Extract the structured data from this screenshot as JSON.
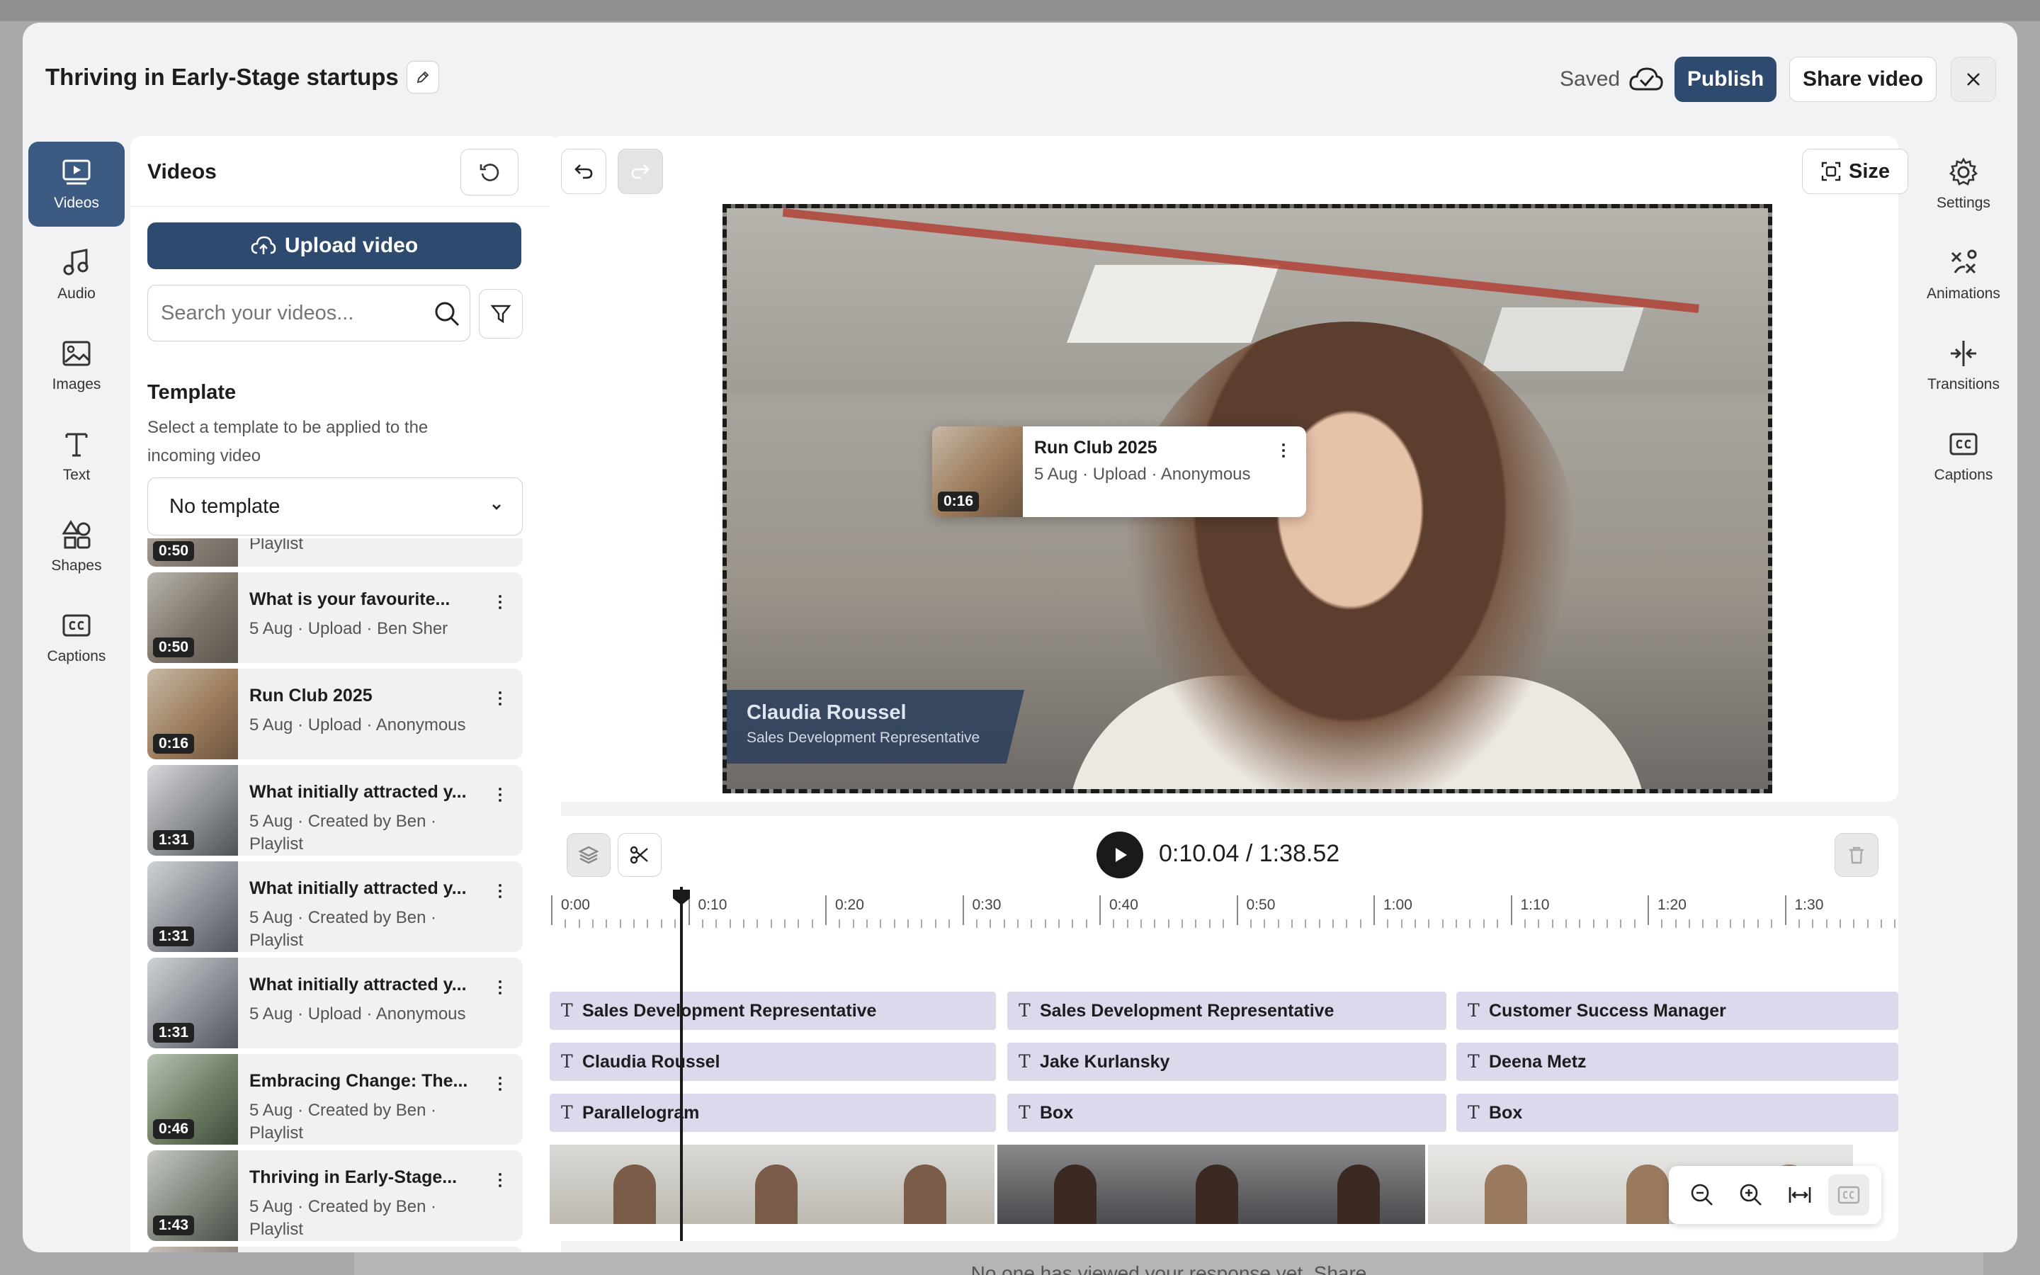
{
  "backdrop": {
    "bottom_text": "No one has viewed your response yet. Share"
  },
  "header": {
    "title": "Thriving in Early-Stage startups",
    "saved_label": "Saved",
    "publish_label": "Publish",
    "share_label": "Share video"
  },
  "left_nav": [
    {
      "label": "Videos",
      "icon": "video-icon",
      "active": true
    },
    {
      "label": "Audio",
      "icon": "music-note-icon"
    },
    {
      "label": "Images",
      "icon": "image-icon"
    },
    {
      "label": "Text",
      "icon": "text-icon"
    },
    {
      "label": "Shapes",
      "icon": "shapes-icon"
    },
    {
      "label": "Captions",
      "icon": "captions-icon"
    }
  ],
  "videos_panel": {
    "title": "Videos",
    "upload_label": "Upload video",
    "search_placeholder": "Search your videos...",
    "template_title": "Template",
    "template_desc": "Select a template to be applied to the incoming video",
    "template_value": "No template",
    "items": [
      {
        "title": "",
        "meta": "Playlist",
        "duration": "0:50"
      },
      {
        "title": "What is your favourite...",
        "meta": "5 Aug · Upload · Ben Sher",
        "duration": "0:50"
      },
      {
        "title": "Run Club 2025",
        "meta": "5 Aug · Upload · Anonymous",
        "duration": "0:16"
      },
      {
        "title": "What initially attracted y...",
        "meta": "5 Aug · Created by Ben · Playlist",
        "duration": "1:31"
      },
      {
        "title": "What initially attracted y...",
        "meta": "5 Aug · Created by Ben · Playlist",
        "duration": "1:31"
      },
      {
        "title": "What initially attracted y...",
        "meta": "5 Aug · Upload · Anonymous",
        "duration": "1:31"
      },
      {
        "title": "Embracing Change: The...",
        "meta": "5 Aug · Created by Ben · Playlist",
        "duration": "0:46"
      },
      {
        "title": "Thriving in Early-Stage...",
        "meta": "5 Aug · Created by Ben · Playlist",
        "duration": "1:43"
      }
    ]
  },
  "preview": {
    "size_label": "Size",
    "lower_third_name": "Claudia Roussel",
    "lower_third_role": "Sales Development Representative",
    "drag_card": {
      "title": "Run Club 2025",
      "meta": "5 Aug · Upload · Anonymous",
      "duration": "0:16"
    }
  },
  "right_nav": [
    {
      "label": "Settings",
      "icon": "gear-icon"
    },
    {
      "label": "Animations",
      "icon": "animations-icon"
    },
    {
      "label": "Transitions",
      "icon": "transitions-icon"
    },
    {
      "label": "Captions",
      "icon": "captions-icon"
    }
  ],
  "timeline": {
    "time_display": "0:10.04 / 1:38.52",
    "ruler_labels": [
      "0:00",
      "0:10",
      "0:20",
      "0:30",
      "0:40",
      "0:50",
      "1:00",
      "1:10",
      "1:20",
      "1:30"
    ],
    "tracks": [
      [
        "Sales Development Representative",
        "Sales Development Representative",
        "Customer Success Manager"
      ],
      [
        "Claudia Roussel",
        "Jake Kurlansky",
        "Deena Metz"
      ],
      [
        "Parallelogram",
        "Box",
        "Box"
      ]
    ]
  },
  "colors": {
    "primary": "#2e4a6e",
    "nav_active": "#3c5a82",
    "track": "#dcd9ec"
  }
}
